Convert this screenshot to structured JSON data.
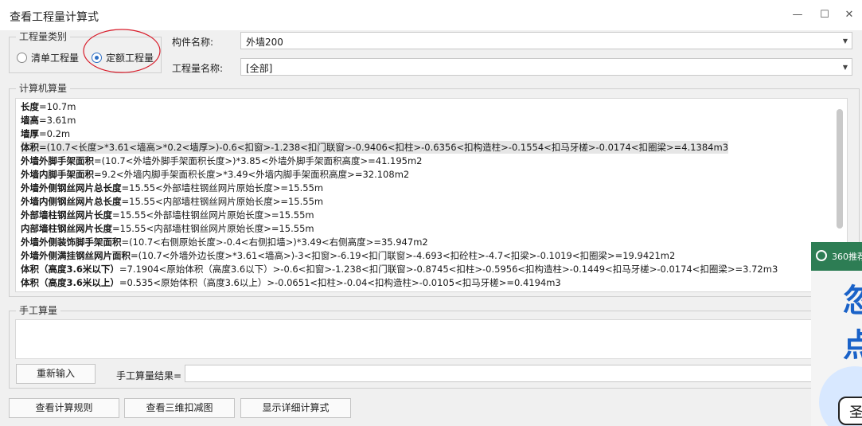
{
  "window": {
    "title": "查看工程量计算式",
    "minimize": "—",
    "maximize": "☐",
    "close": "✕"
  },
  "category": {
    "legend": "工程量类别",
    "option1": "清单工程量",
    "option2": "定额工程量",
    "selected": "定额工程量"
  },
  "component": {
    "label": "构件名称:",
    "value": "外墙200"
  },
  "quantity": {
    "label": "工程量名称:",
    "value": "[全部]"
  },
  "computer": {
    "legend": "计算机算量",
    "lines": [
      {
        "name": "长度",
        "expr": "=10.7m"
      },
      {
        "name": "墙高",
        "expr": "=3.61m"
      },
      {
        "name": "墙厚",
        "expr": "=0.2m"
      },
      {
        "name": "体积",
        "expr": "=(10.7<长度>*3.61<墙高>*0.2<墙厚>)-0.6<扣窗>-1.238<扣门联窗>-0.9406<扣柱>-0.6356<扣构造柱>-0.1554<扣马牙槎>-0.0174<扣圈梁>=4.1384m3"
      },
      {
        "name": "外墙外脚手架面积",
        "expr": "=(10.7<外墙外脚手架面积长度>)*3.85<外墙外脚手架面积高度>=41.195m2"
      },
      {
        "name": "外墙内脚手架面积",
        "expr": "=9.2<外墙内脚手架面积长度>*3.49<外墙内脚手架面积高度>=32.108m2"
      },
      {
        "name": "外墙外侧钢丝网片总长度",
        "expr": "=15.55<外部墙柱钢丝网片原始长度>=15.55m"
      },
      {
        "name": "外墙内侧钢丝网片总长度",
        "expr": "=15.55<内部墙柱钢丝网片原始长度>=15.55m"
      },
      {
        "name": "外部墙柱钢丝网片长度",
        "expr": "=15.55<外部墙柱钢丝网片原始长度>=15.55m"
      },
      {
        "name": "内部墙柱钢丝网片长度",
        "expr": "=15.55<内部墙柱钢丝网片原始长度>=15.55m"
      },
      {
        "name": "外墙外侧装饰脚手架面积",
        "expr": "=(10.7<右侧原始长度>-0.4<右侧扣墙>)*3.49<右侧高度>=35.947m2"
      },
      {
        "name": "外墙外侧满挂钢丝网片面积",
        "expr": "=(10.7<外墙外边长度>*3.61<墙高>)-3<扣窗>-6.19<扣门联窗>-4.693<扣砼柱>-4.7<扣梁>-0.1019<扣圈梁>=19.9421m2"
      },
      {
        "name": "体积（高度3.6米以下）",
        "expr": "=7.1904<原始体积（高度3.6以下）>-0.6<扣窗>-1.238<扣门联窗>-0.8745<扣柱>-0.5956<扣构造柱>-0.1449<扣马牙槎>-0.0174<扣圈梁>=3.72m3"
      },
      {
        "name": "体积（高度3.6米以上）",
        "expr": "=0.535<原始体积（高度3.6以上）>-0.0651<扣柱>-0.04<扣构造柱>-0.0105<扣马牙槎>=0.4194m3"
      }
    ]
  },
  "manual": {
    "legend": "手工算量",
    "reinput": "重新输入",
    "result_label": "手工算量结果=",
    "result_value": ""
  },
  "buttons": {
    "rules": "查看计算规则",
    "view3d": "查看三维扣减图",
    "detail": "显示详细计算式"
  },
  "ad": {
    "header": "360推荐",
    "char1": "忽",
    "char2": "点",
    "char3": "圣"
  },
  "colors": {
    "annotation": "#d81c2a",
    "radio_selected": "#2e6fc4",
    "ad_bg": "#3a8f63"
  }
}
